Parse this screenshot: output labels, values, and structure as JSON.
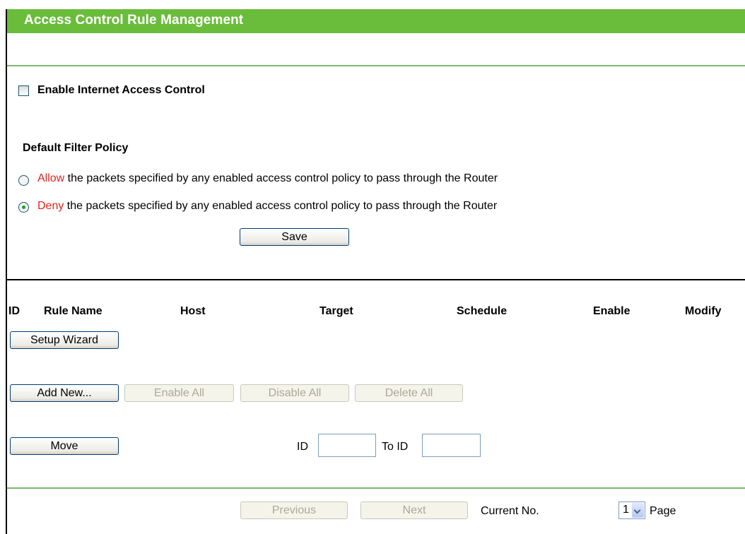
{
  "header": {
    "title": "Access Control Rule Management"
  },
  "enable_control": {
    "label": "Enable Internet Access Control",
    "checked": false
  },
  "policy": {
    "title": "Default Filter Policy",
    "selected": "deny",
    "allow": {
      "keyword": "Allow",
      "text": " the packets specified by any enabled access control policy to pass through the Router"
    },
    "deny": {
      "keyword": "Deny",
      "text": " the packets specified by any enabled access control policy to pass through the Router"
    },
    "save_label": "Save"
  },
  "table": {
    "columns": [
      "ID",
      "Rule Name",
      "Host",
      "Target",
      "Schedule",
      "Enable",
      "Modify"
    ]
  },
  "actions": {
    "setup_wizard": "Setup Wizard",
    "add_new": "Add New...",
    "enable_all": "Enable All",
    "disable_all": "Disable All",
    "delete_all": "Delete All"
  },
  "move": {
    "button_label": "Move",
    "id_label": "ID",
    "to_id_label": "To ID",
    "id_value": "",
    "to_id_value": ""
  },
  "pagination": {
    "previous_label": "Previous",
    "next_label": "Next",
    "current_label": "Current No.",
    "current_page": "1",
    "page_label": "Page"
  },
  "colors": {
    "header_green": "#6abd3b",
    "accent_red": "#e5221a",
    "divider_green": "#7ab86b"
  }
}
